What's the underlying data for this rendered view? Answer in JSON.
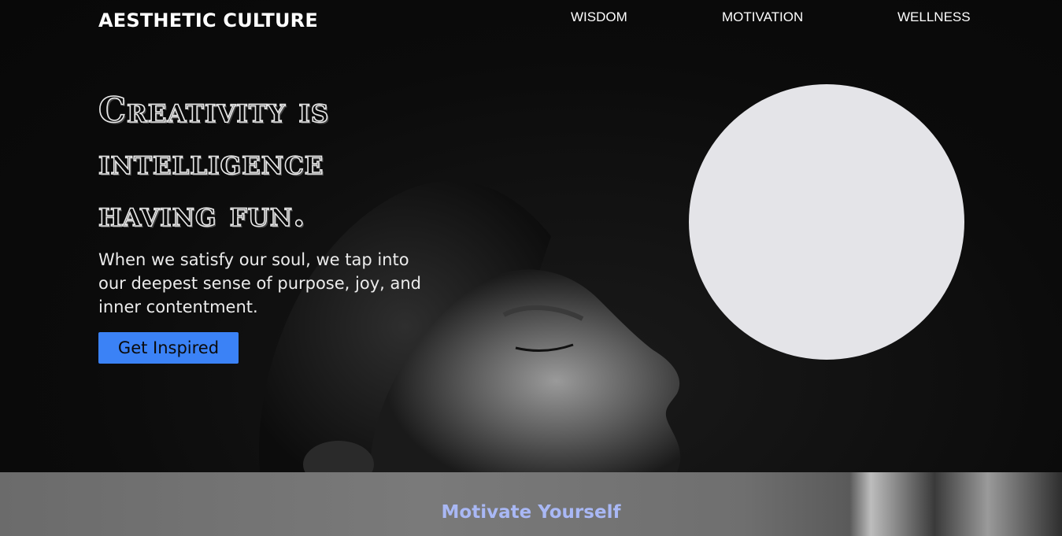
{
  "brand": {
    "name": "AESTHETIC CULTURE"
  },
  "nav": {
    "links": [
      {
        "label": "WISDOM"
      },
      {
        "label": "MOTIVATION"
      },
      {
        "label": "WELLNESS"
      }
    ]
  },
  "hero": {
    "headline": "Creativity is intelligence having fun.",
    "subtext": "When we satisfy our soul, we tap into our deepest sense of purpose, joy, and inner contentment.",
    "cta_label": "Get Inspired"
  },
  "section2": {
    "title": "Motivate Yourself"
  },
  "colors": {
    "accent": "#3b82f6",
    "circle": "#e4e4e8",
    "section_title": "#a9b8f5",
    "background": "#0a0a0a"
  }
}
